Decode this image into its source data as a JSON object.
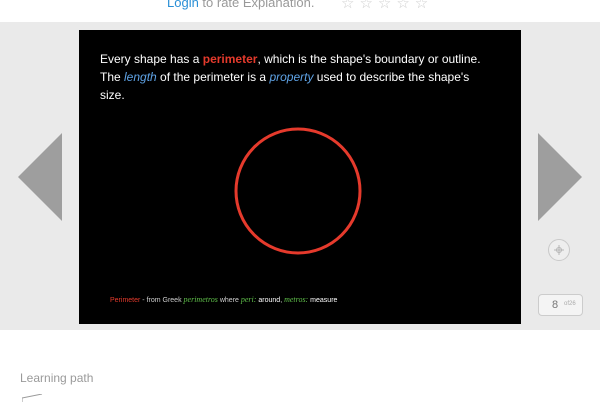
{
  "rating": {
    "login": "Login",
    "rest": " to rate Explanation.",
    "stars": "☆☆☆☆☆"
  },
  "slide": {
    "line1_a": "Every shape has a ",
    "line1_b": "perimeter",
    "line1_c": ", which is the shape's boundary or outline.",
    "line2_a": "The ",
    "line2_b": "length",
    "line2_c": " of the perimeter is a ",
    "line2_d": "property",
    "line2_e": " used to describe the shape's",
    "line3": "size.",
    "footnote": {
      "term": "Perimeter",
      "from": " - from Greek ",
      "greek": "perimetros",
      "where": " where ",
      "peri": "peri:",
      "around": " around",
      "comma": ", ",
      "metros": "metros:",
      "measure": " measure"
    },
    "circle_color": "#e53a2c"
  },
  "pager": {
    "current": "8",
    "of": "of26"
  },
  "learning_path": {
    "label": "Learning path"
  },
  "colors": {
    "accent_red": "#e53a2c",
    "accent_blue": "#5fa3e6",
    "link": "#2a8fd6",
    "stage_bg": "#eaeaea"
  }
}
